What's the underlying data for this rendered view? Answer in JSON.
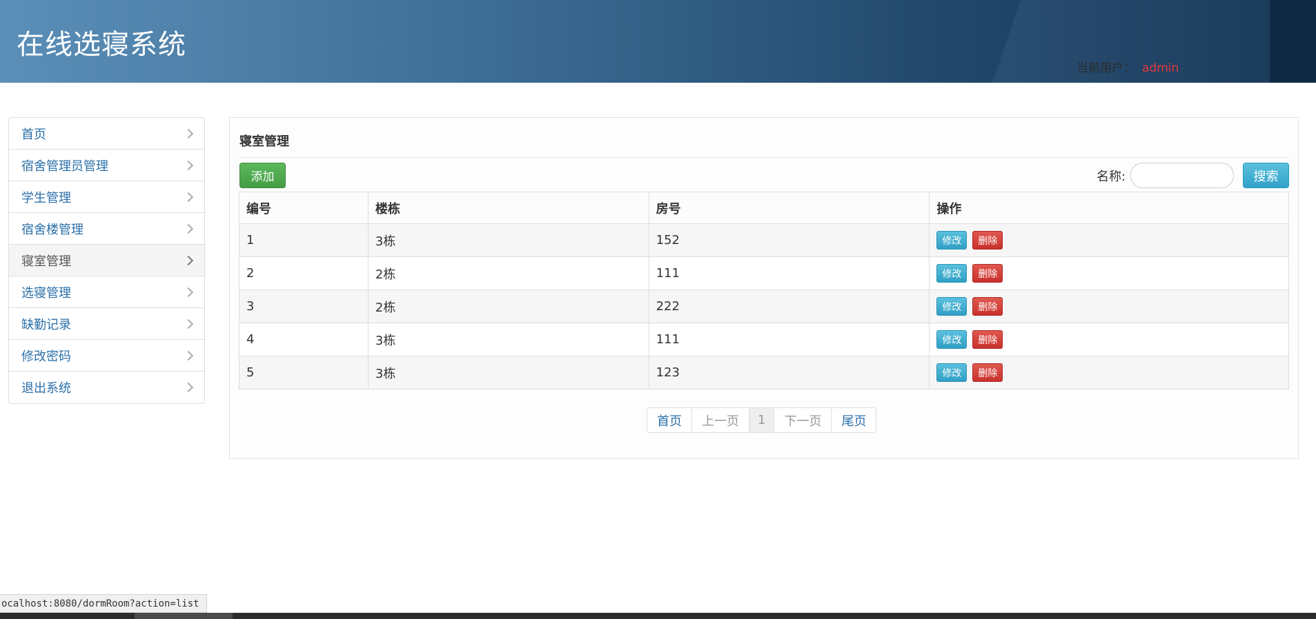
{
  "header": {
    "title": "在线选寝系统",
    "user_label": "当前用户：",
    "user_name": "admin"
  },
  "sidebar": {
    "items": [
      {
        "label": "首页"
      },
      {
        "label": "宿舍管理员管理"
      },
      {
        "label": "学生管理"
      },
      {
        "label": "宿舍楼管理"
      },
      {
        "label": "寝室管理"
      },
      {
        "label": "选寝管理"
      },
      {
        "label": "缺勤记录"
      },
      {
        "label": "修改密码"
      },
      {
        "label": "退出系统"
      }
    ],
    "active_index": 4
  },
  "main": {
    "title": "寝室管理",
    "add_label": "添加",
    "search_label": "名称:",
    "search_value": "",
    "search_button": "搜索",
    "columns": [
      "编号",
      "楼栋",
      "房号",
      "操作"
    ],
    "rows": [
      {
        "id": "1",
        "building": "3栋",
        "room": "152"
      },
      {
        "id": "2",
        "building": "2栋",
        "room": "111"
      },
      {
        "id": "3",
        "building": "2栋",
        "room": "222"
      },
      {
        "id": "4",
        "building": "3栋",
        "room": "111"
      },
      {
        "id": "5",
        "building": "3栋",
        "room": "123"
      }
    ],
    "edit_label": "修改",
    "delete_label": "删除",
    "pager": {
      "first": "首页",
      "prev": "上一页",
      "current": "1",
      "next": "下一页",
      "last": "尾页"
    }
  },
  "status_bar": {
    "url": "ocalhost:8080/dormRoom?action=list"
  },
  "colors": {
    "header_gradient_start": "#5b8fb8",
    "header_gradient_end": "#13304d",
    "user_name": "#e4393c",
    "link": "#2a6fa8",
    "add_button": "#5cb85c",
    "search_button": "#5bc0de",
    "delete_button": "#d9534f"
  }
}
